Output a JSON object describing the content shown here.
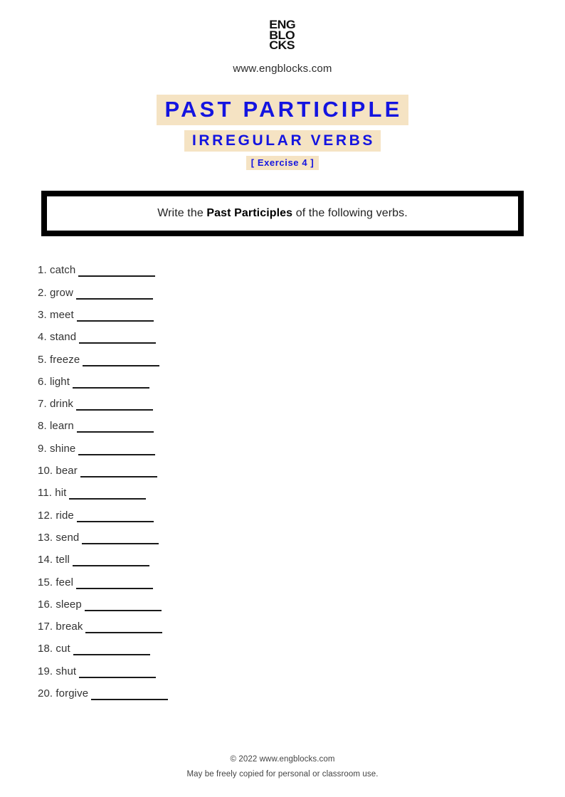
{
  "header": {
    "logo_lines": [
      "ENG",
      "BLO",
      "CKS"
    ],
    "site_url": "www.engblocks.com"
  },
  "titles": {
    "main": "PAST PARTICIPLE",
    "sub": "IRREGULAR VERBS",
    "exercise": "[ Exercise 4 ]",
    "highlight_color": "#f5e3c3",
    "text_color": "#1414e0"
  },
  "instruction": {
    "prefix": "Write the ",
    "bold": "Past Participles",
    "suffix": " of the following verbs."
  },
  "exercise": {
    "items": [
      {
        "number": "1.",
        "verb": "catch"
      },
      {
        "number": "2.",
        "verb": "grow"
      },
      {
        "number": "3.",
        "verb": "meet"
      },
      {
        "number": "4.",
        "verb": "stand"
      },
      {
        "number": "5.",
        "verb": "freeze"
      },
      {
        "number": "6.",
        "verb": "light"
      },
      {
        "number": "7.",
        "verb": "drink"
      },
      {
        "number": "8.",
        "verb": "learn"
      },
      {
        "number": "9.",
        "verb": "shine"
      },
      {
        "number": "10.",
        "verb": "bear"
      },
      {
        "number": "11.",
        "verb": "hit"
      },
      {
        "number": "12.",
        "verb": "ride"
      },
      {
        "number": "13.",
        "verb": "send"
      },
      {
        "number": "14.",
        "verb": "tell"
      },
      {
        "number": "15.",
        "verb": "feel"
      },
      {
        "number": "16.",
        "verb": "sleep"
      },
      {
        "number": "17.",
        "verb": "break"
      },
      {
        "number": "18.",
        "verb": "cut"
      },
      {
        "number": "19.",
        "verb": "shut"
      },
      {
        "number": "20.",
        "verb": "forgive"
      }
    ]
  },
  "footer": {
    "copyright": "© 2022 www.engblocks.com",
    "notice": "May be freely copied for personal or classroom use."
  }
}
